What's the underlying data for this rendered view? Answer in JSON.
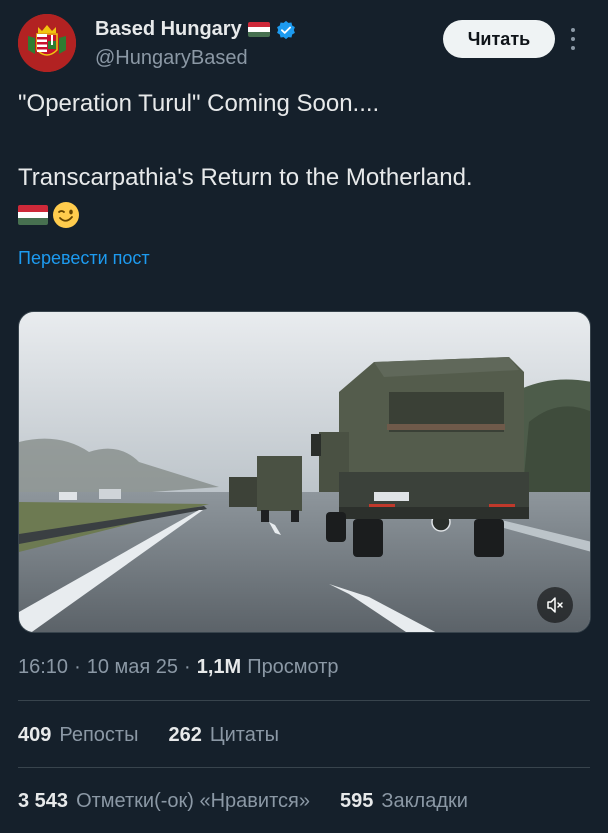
{
  "author": {
    "display_name": "Based Hungary",
    "handle": "@HungaryBased",
    "verified": true,
    "avatar_icon": "hungarian-coat-of-arms-icon"
  },
  "follow_label": "Читать",
  "tweet": {
    "line1": "\"Operation Turul\" Coming Soon....",
    "line2": "Transcarpathia's Return to the Motherland.",
    "emoji": [
      "hungarian-flag-icon",
      "winking-face-icon"
    ]
  },
  "translate_label": "Перевести пост",
  "media": {
    "type": "video",
    "description_icon": "military-trucks-on-highway",
    "mute_icon": "speaker-muted-icon"
  },
  "meta": {
    "time": "16:10",
    "date": "10 мая 25",
    "views_count": "1,1M",
    "views_label": "Просмотр",
    "separator": "·"
  },
  "stats": {
    "reposts_count": "409",
    "reposts_label": "Репосты",
    "quotes_count": "262",
    "quotes_label": "Цитаты",
    "likes_count": "3 543",
    "likes_label": "Отметки(-ок) «Нравится»",
    "bookmarks_count": "595",
    "bookmarks_label": "Закладки"
  },
  "colors": {
    "background": "#15202b",
    "accent": "#1d9bf0",
    "text": "#e7e9ea",
    "muted": "#8b98a5"
  }
}
